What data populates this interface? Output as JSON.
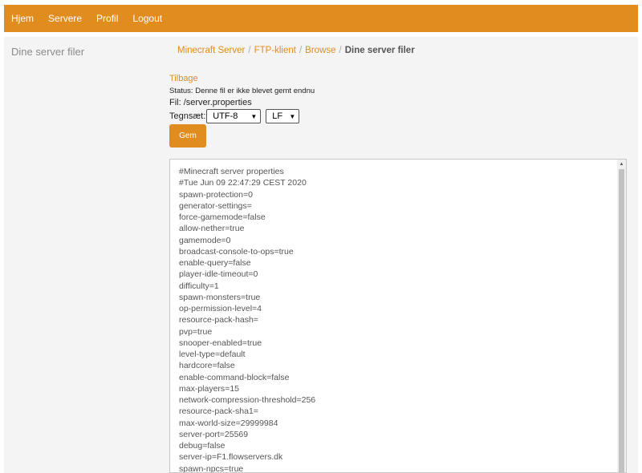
{
  "nav": {
    "items": [
      "Hjem",
      "Servere",
      "Profil",
      "Logout"
    ]
  },
  "sidebar": {
    "title": "Dine server filer"
  },
  "breadcrumb": {
    "items": [
      "Minecraft Server",
      "FTP-klient",
      "Browse"
    ],
    "current": "Dine server filer",
    "separator": "/"
  },
  "main": {
    "back_label": "Tilbage",
    "status": "Status: Denne fil er ikke blevet gemt endnu",
    "file_path": "Fil: /server.properties",
    "charset_label": "Tegnsæt:",
    "charset_value": "UTF-8",
    "line_ending_value": "LF",
    "save_label": "Gem"
  },
  "editor": {
    "lines": [
      "#Minecraft server properties",
      "#Tue Jun 09 22:47:29 CEST 2020",
      "spawn-protection=0",
      "generator-settings=",
      "force-gamemode=false",
      "allow-nether=true",
      "gamemode=0",
      "broadcast-console-to-ops=true",
      "enable-query=false",
      "player-idle-timeout=0",
      "difficulty=1",
      "spawn-monsters=true",
      "op-permission-level=4",
      "resource-pack-hash=",
      "pvp=true",
      "snooper-enabled=true",
      "level-type=default",
      "hardcore=false",
      "enable-command-block=false",
      "max-players=15",
      "network-compression-threshold=256",
      "resource-pack-sha1=",
      "max-world-size=29999984",
      "server-port=25569",
      "debug=false",
      "server-ip=F1.flowservers.dk",
      "spawn-npcs=true"
    ]
  },
  "colors": {
    "accent": "#e08c1e",
    "page_bg": "#f4f4f4"
  }
}
